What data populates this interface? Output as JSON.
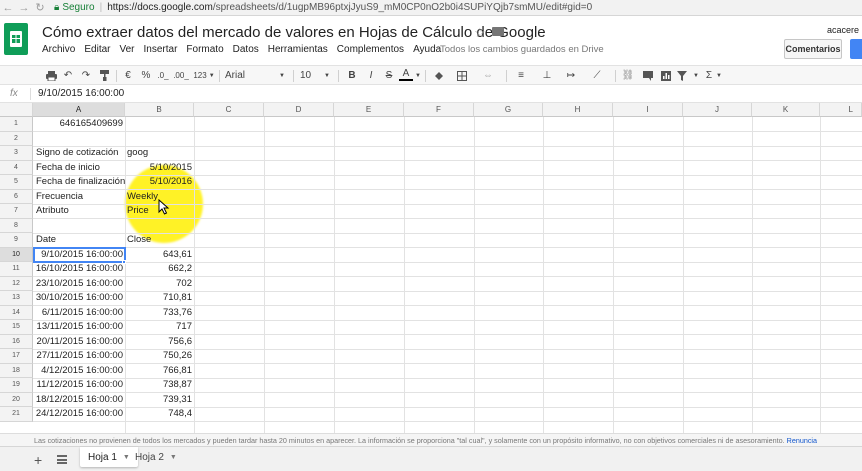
{
  "browser": {
    "secure_label": "Seguro",
    "url_domain": "https://docs.google.com",
    "url_path": "/spreadsheets/d/1ugpMB96ptxjJyuS9_mM0CP0nO2b0i4SUPiYQjb7smMU/edit#gid=0"
  },
  "app": {
    "title": "Cómo extraer datos del mercado de valores en Hojas de Cálculo de Google",
    "user_name": "acacere",
    "comments_label": "Comentarios",
    "save_status": "Todos los cambios guardados en Drive",
    "menu": [
      "Archivo",
      "Editar",
      "Ver",
      "Insertar",
      "Formato",
      "Datos",
      "Herramientas",
      "Complementos",
      "Ayuda"
    ]
  },
  "toolbar": {
    "currency": "€",
    "percent": "%",
    "decimal_decrease": ".0_",
    "decimal_increase": ".00_",
    "number_format": "123",
    "font": "Arial",
    "font_size": "10",
    "bold": "B",
    "italic": "I",
    "strike": "S",
    "text_color": "A",
    "functions": "Σ"
  },
  "formula_bar": {
    "fx": "fx",
    "value": "9/10/2015 16:00:00"
  },
  "grid": {
    "columns": [
      "A",
      "B",
      "C",
      "D",
      "E",
      "F",
      "G",
      "H",
      "I",
      "J",
      "K",
      "L"
    ],
    "rows": [
      "1",
      "2",
      "3",
      "4",
      "5",
      "6",
      "7",
      "8",
      "9",
      "10",
      "11",
      "12",
      "13",
      "14",
      "15",
      "16",
      "17",
      "18",
      "19",
      "20",
      "21"
    ],
    "cells": {
      "r1": {
        "a": "646165409699"
      },
      "r3": {
        "a": "Signo de cotización",
        "b": "goog"
      },
      "r4": {
        "a": "Fecha de inicio",
        "b": "5/10/2015"
      },
      "r5": {
        "a": "Fecha de finalización",
        "b": "5/10/2016"
      },
      "r6": {
        "a": "Frecuencia",
        "b": "Weekly"
      },
      "r7": {
        "a": "Atributo",
        "b": "Price"
      },
      "r9": {
        "a": "Date",
        "b": "Close"
      }
    },
    "data_rows": [
      {
        "date": "9/10/2015 16:00:00",
        "close": "643,61"
      },
      {
        "date": "16/10/2015 16:00:00",
        "close": "662,2"
      },
      {
        "date": "23/10/2015 16:00:00",
        "close": "702"
      },
      {
        "date": "30/10/2015 16:00:00",
        "close": "710,81"
      },
      {
        "date": "6/11/2015 16:00:00",
        "close": "733,76"
      },
      {
        "date": "13/11/2015 16:00:00",
        "close": "717"
      },
      {
        "date": "20/11/2015 16:00:00",
        "close": "756,6"
      },
      {
        "date": "27/11/2015 16:00:00",
        "close": "750,26"
      },
      {
        "date": "4/12/2015 16:00:00",
        "close": "766,81"
      },
      {
        "date": "11/12/2015 16:00:00",
        "close": "738,87"
      },
      {
        "date": "18/12/2015 16:00:00",
        "close": "739,31"
      },
      {
        "date": "24/12/2015 16:00:00",
        "close": "748,4"
      }
    ]
  },
  "footer": {
    "disclaimer": "Las cotizaciones no provienen de todos los mercados y pueden tardar hasta 20 minutos en aparecer. La información se proporciona \"tal cual\", y solamente con un propósito informativo, no con objetivos comerciales ni de asesoramiento.",
    "disclaimer_link": "Renuncia",
    "sheets": [
      "Hoja 1",
      "Hoja 2"
    ]
  },
  "colors": {
    "brand_green": "#0f9d58",
    "selection_blue": "#4285f4",
    "cursor_highlight": "#fff000"
  }
}
